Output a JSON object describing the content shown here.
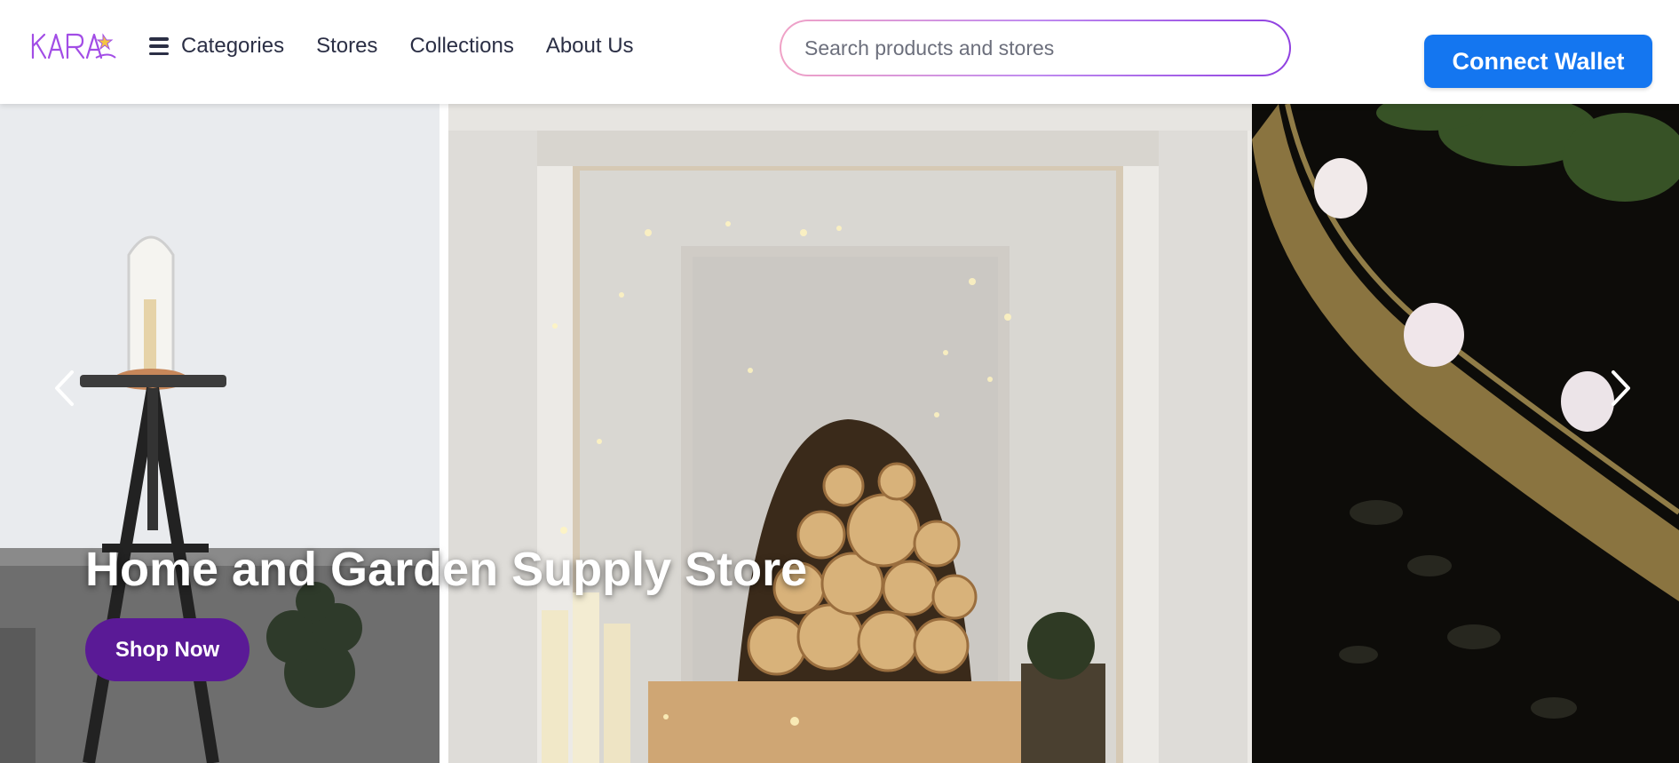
{
  "header": {
    "logo_text": "KARA",
    "nav": [
      {
        "label": "Categories",
        "icon": "menu-icon"
      },
      {
        "label": "Stores"
      },
      {
        "label": "Collections"
      },
      {
        "label": "About Us"
      }
    ],
    "search": {
      "placeholder": "Search products and stores",
      "value": ""
    },
    "connect_wallet_label": "Connect Wallet"
  },
  "hero": {
    "title": "Home and Garden Supply Store",
    "cta_label": "Shop Now",
    "prev_icon": "chevron-left-icon",
    "next_icon": "chevron-right-icon"
  },
  "colors": {
    "primary_blue": "#1476f0",
    "cta_purple": "#5a1a96",
    "logo_purple": "#8f3fe0",
    "search_gradient_start": "#f0a2c6",
    "search_gradient_end": "#8f3fe0",
    "nav_text": "#2b2f45"
  }
}
